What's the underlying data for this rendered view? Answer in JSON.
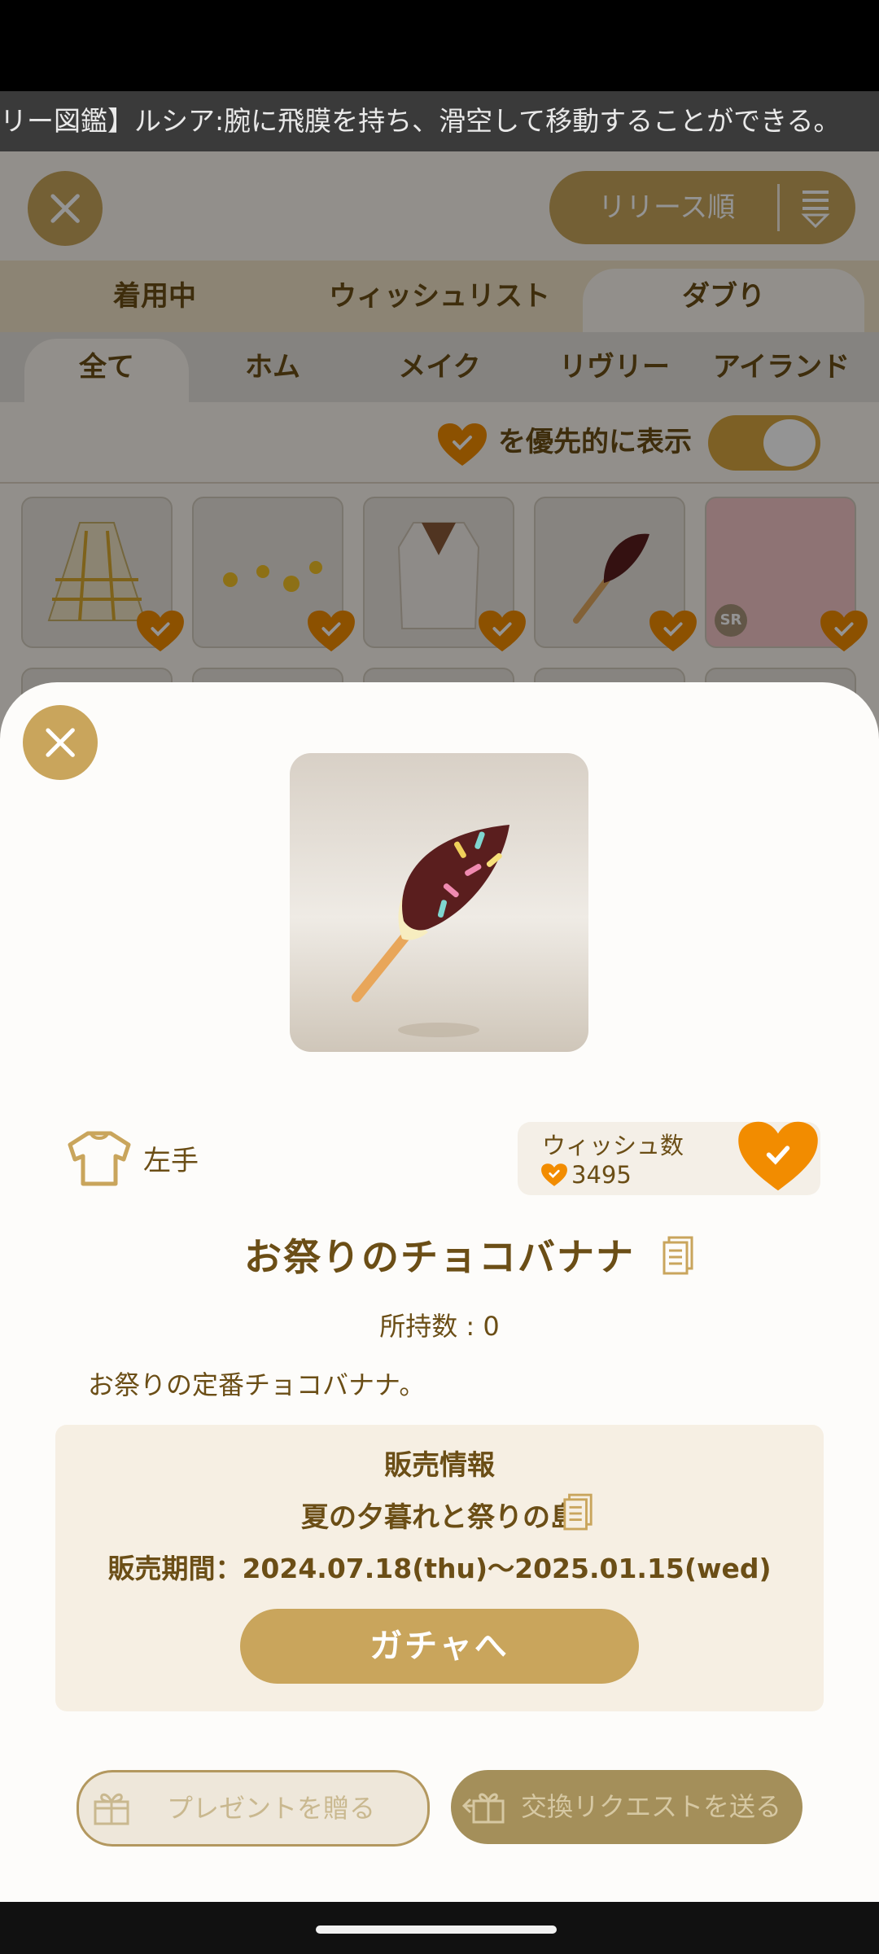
{
  "ticker": {
    "text": "リー図鑑】ルシア:腕に飛膜を持ち、滑空して移動することができる。"
  },
  "header": {
    "sort_label": "リリース順"
  },
  "tabs": [
    "着用中",
    "ウィッシュリスト",
    "ダブり"
  ],
  "subtabs": [
    "全て",
    "ホム",
    "メイク",
    "リヴリー",
    "アイランド"
  ],
  "priority": {
    "label": "を優先的に表示",
    "enabled": true
  },
  "grid": {
    "rarity_badge": "SR"
  },
  "item": {
    "slot": "左手",
    "wish_label": "ウィッシュ数",
    "wish_count": "3495",
    "name": "お祭りのチョコバナナ",
    "owned": "所持数 : 0",
    "description": "お祭りの定番チョコバナナ。"
  },
  "sales": {
    "title": "販売情報",
    "event": "夏の夕暮れと祭りの島",
    "period": "販売期間：2024.07.18(thu)〜2025.01.15(wed)",
    "gacha_button": "ガチャへ"
  },
  "actions": {
    "gift": "プレゼントを贈る",
    "trade": "交換リクエストを送る"
  },
  "colors": {
    "accent": "#c9a55c",
    "heart": "#f28c00",
    "text": "#6b4e16"
  }
}
